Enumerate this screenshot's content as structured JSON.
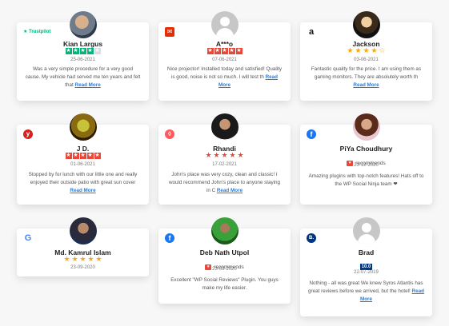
{
  "reviews": [
    {
      "name": "Kian Largus",
      "platform": "trustpilot",
      "platform_label": "Trustpilot",
      "date": "25-06-2021",
      "text": "Was a very simple procedure for a very good cause. My vehicle had served me ten years and felt that",
      "read_more": "Read More"
    },
    {
      "name": "A***o",
      "platform": "aliexpress",
      "date": "07-06-2021",
      "text": "Nice projector! Installed today and satisfied! Quality is good, noise is not so much. I will test th",
      "read_more": "Read More"
    },
    {
      "name": "Jackson",
      "platform": "amazon",
      "date": "03-06-2021",
      "text": "Fantastic quality for the price. I am using them as gaming monitors. They are absolutely worth th",
      "read_more": "Read More"
    },
    {
      "name": "J D.",
      "platform": "yelp",
      "date": "01-06-2021",
      "text": "Stopped by for lunch with our little one and really enjoyed their outside patio with great sun cover",
      "read_more": "Read More"
    },
    {
      "name": "Rhandi",
      "platform": "airbnb",
      "date": "17-02-2021",
      "text": "John's place was very cozy, clean and classic! I would recommend John's place to anyone staying in C",
      "read_more": "Read More"
    },
    {
      "name": "PiYa Choudhury",
      "platform": "facebook",
      "recommend": "recommends",
      "date": "23-12-2020",
      "text": "Amazing plugins with top-notch features! Hats off to the WP Social Ninja team ❤"
    },
    {
      "name": "Md. Kamrul Islam",
      "platform": "google",
      "date": "23-09-2020"
    },
    {
      "name": "Deb Nath Utpol",
      "platform": "facebook",
      "recommend": "recommends",
      "date": "23-03-2020",
      "text": "Excellent \"WP Social Reviews\" Plugin. You guys make my life easier."
    },
    {
      "name": "Brad",
      "platform": "booking",
      "score": "10.0",
      "date": "22-07-2019",
      "text": "Nothing - all was great We knew Syros Atlantis has great reviews before we arrived, but the hotel!",
      "read_more": "Read More"
    }
  ],
  "ratings": {
    "kian": 4,
    "ao": 5,
    "jackson": 4,
    "jd": 5,
    "rhandi": 5,
    "kamrul": 5
  }
}
